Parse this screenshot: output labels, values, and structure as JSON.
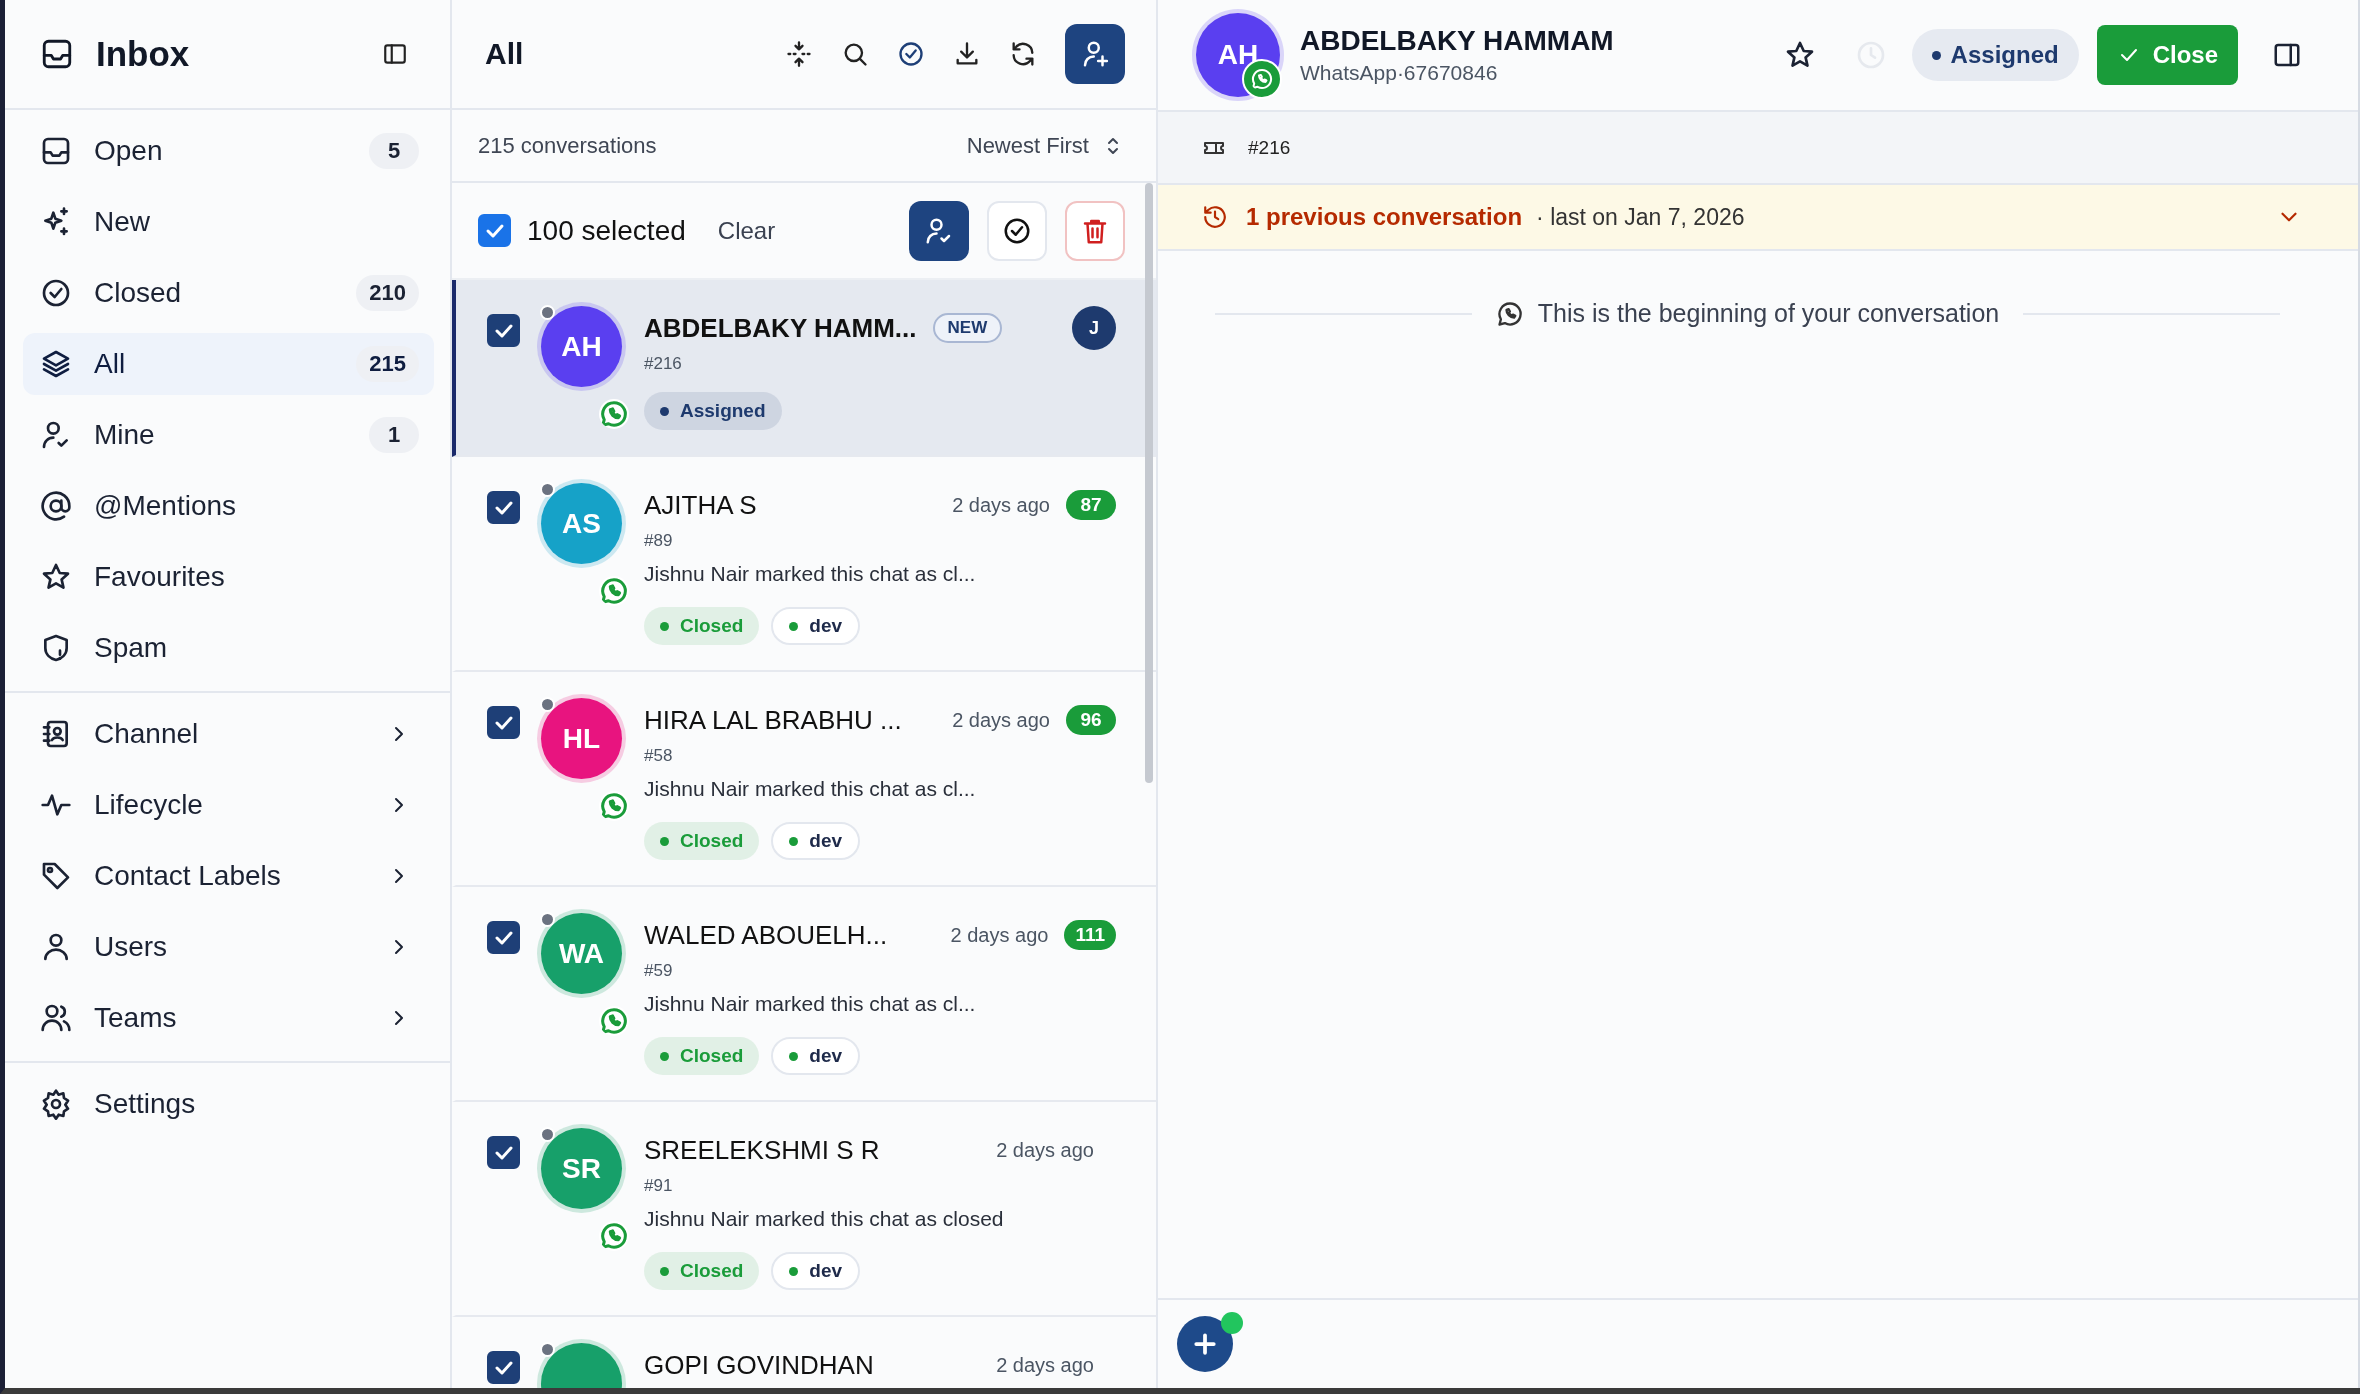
{
  "sidebar": {
    "title": "Inbox",
    "sections": [
      [
        {
          "kind": "filter",
          "label": "Open",
          "count": "5",
          "selected": false
        },
        {
          "kind": "filter",
          "label": "New",
          "selected": false
        },
        {
          "kind": "filter",
          "label": "Closed",
          "count": "210",
          "selected": false
        },
        {
          "kind": "filter",
          "label": "All",
          "count": "215",
          "selected": true
        },
        {
          "kind": "filter",
          "label": "Mine",
          "count": "1",
          "selected": false
        },
        {
          "kind": "filter",
          "label": "@Mentions",
          "selected": false
        },
        {
          "kind": "filter",
          "label": "Favourites",
          "selected": false
        },
        {
          "kind": "filter",
          "label": "Spam",
          "selected": false
        }
      ],
      [
        {
          "kind": "submenu",
          "label": "Channel",
          "selected": false
        },
        {
          "kind": "submenu",
          "label": "Lifecycle",
          "selected": false
        },
        {
          "kind": "submenu",
          "label": "Contact Labels",
          "selected": false
        },
        {
          "kind": "submenu",
          "label": "Users",
          "selected": false
        },
        {
          "kind": "submenu",
          "label": "Teams",
          "selected": false
        }
      ],
      [
        {
          "kind": "link",
          "label": "Settings",
          "selected": false
        }
      ]
    ]
  },
  "list": {
    "title": "All",
    "summary": "215 conversations",
    "sort": "Newest First",
    "selection": {
      "checked": true,
      "label": "100 selected",
      "clear": "Clear"
    },
    "conversations": [
      {
        "checked": true,
        "selected": true,
        "online": false,
        "initials": "AH",
        "color": "#5a3ff0",
        "name": "ABDELBAKY HAMM...",
        "badge": "NEW",
        "assignee": "J",
        "ticket": "#216",
        "tags": [
          {
            "kind": "status",
            "label": "Assigned",
            "color": "#1e3a6e"
          }
        ]
      },
      {
        "checked": true,
        "selected": false,
        "online": false,
        "initials": "AS",
        "color": "#16a2c8",
        "name": "AJITHA S",
        "time": "2 days ago",
        "unread": "87",
        "ticket": "#89",
        "preview": "Jishnu Nair marked this chat as cl...",
        "tags": [
          {
            "kind": "status",
            "label": "Closed",
            "color": "#1a9c3a"
          },
          {
            "kind": "label",
            "label": "dev",
            "color": "#1a9c3a"
          }
        ]
      },
      {
        "checked": true,
        "selected": false,
        "online": false,
        "initials": "HL",
        "color": "#e8147f",
        "name": "HIRA LAL BRABHU ...",
        "time": "2 days ago",
        "unread": "96",
        "ticket": "#58",
        "preview": "Jishnu Nair marked this chat as cl...",
        "tags": [
          {
            "kind": "status",
            "label": "Closed",
            "color": "#1a9c3a"
          },
          {
            "kind": "label",
            "label": "dev",
            "color": "#1a9c3a"
          }
        ]
      },
      {
        "checked": true,
        "selected": false,
        "online": false,
        "initials": "WA",
        "color": "#17a06a",
        "name": "WALED ABOUELH...",
        "time": "2 days ago",
        "unread": "111",
        "ticket": "#59",
        "preview": "Jishnu Nair marked this chat as cl...",
        "tags": [
          {
            "kind": "status",
            "label": "Closed",
            "color": "#1a9c3a"
          },
          {
            "kind": "label",
            "label": "dev",
            "color": "#1a9c3a"
          }
        ]
      },
      {
        "checked": true,
        "selected": false,
        "online": false,
        "initials": "SR",
        "color": "#17a06a",
        "name": "SREELEKSHMI S R",
        "time": "2 days ago",
        "ticket": "#91",
        "preview": "Jishnu Nair marked this chat as closed",
        "tags": [
          {
            "kind": "status",
            "label": "Closed",
            "color": "#1a9c3a"
          },
          {
            "kind": "label",
            "label": "dev",
            "color": "#1a9c3a"
          }
        ]
      },
      {
        "checked": true,
        "selected": false,
        "online": false,
        "color": "#17a06a",
        "name": "GOPI GOVINDHAN",
        "time": "2 days ago"
      }
    ]
  },
  "chat": {
    "initials": "AH",
    "color": "#5a3ff0",
    "name": "ABDELBAKY HAMMAM",
    "subtitle": "WhatsApp·67670846",
    "starred": false,
    "snooze_disabled": true,
    "status": "Assigned",
    "close": "Close",
    "ticket": "#216",
    "history": {
      "title": "1 previous conversation",
      "detail": "· last on Jan 7, 2026",
      "expanded": false
    },
    "start": "This is the beginning of your conversation"
  }
}
